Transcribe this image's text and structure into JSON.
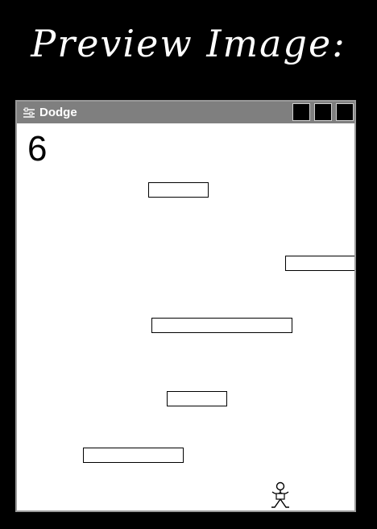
{
  "banner": {
    "text": "Preview Image:"
  },
  "window": {
    "title": "Dodge",
    "icon": "sliders-icon",
    "buttons": [
      "minimize",
      "maximize",
      "close"
    ]
  },
  "game": {
    "score": "6",
    "obstacle_count": 5,
    "player": "stick-figure-icon"
  }
}
